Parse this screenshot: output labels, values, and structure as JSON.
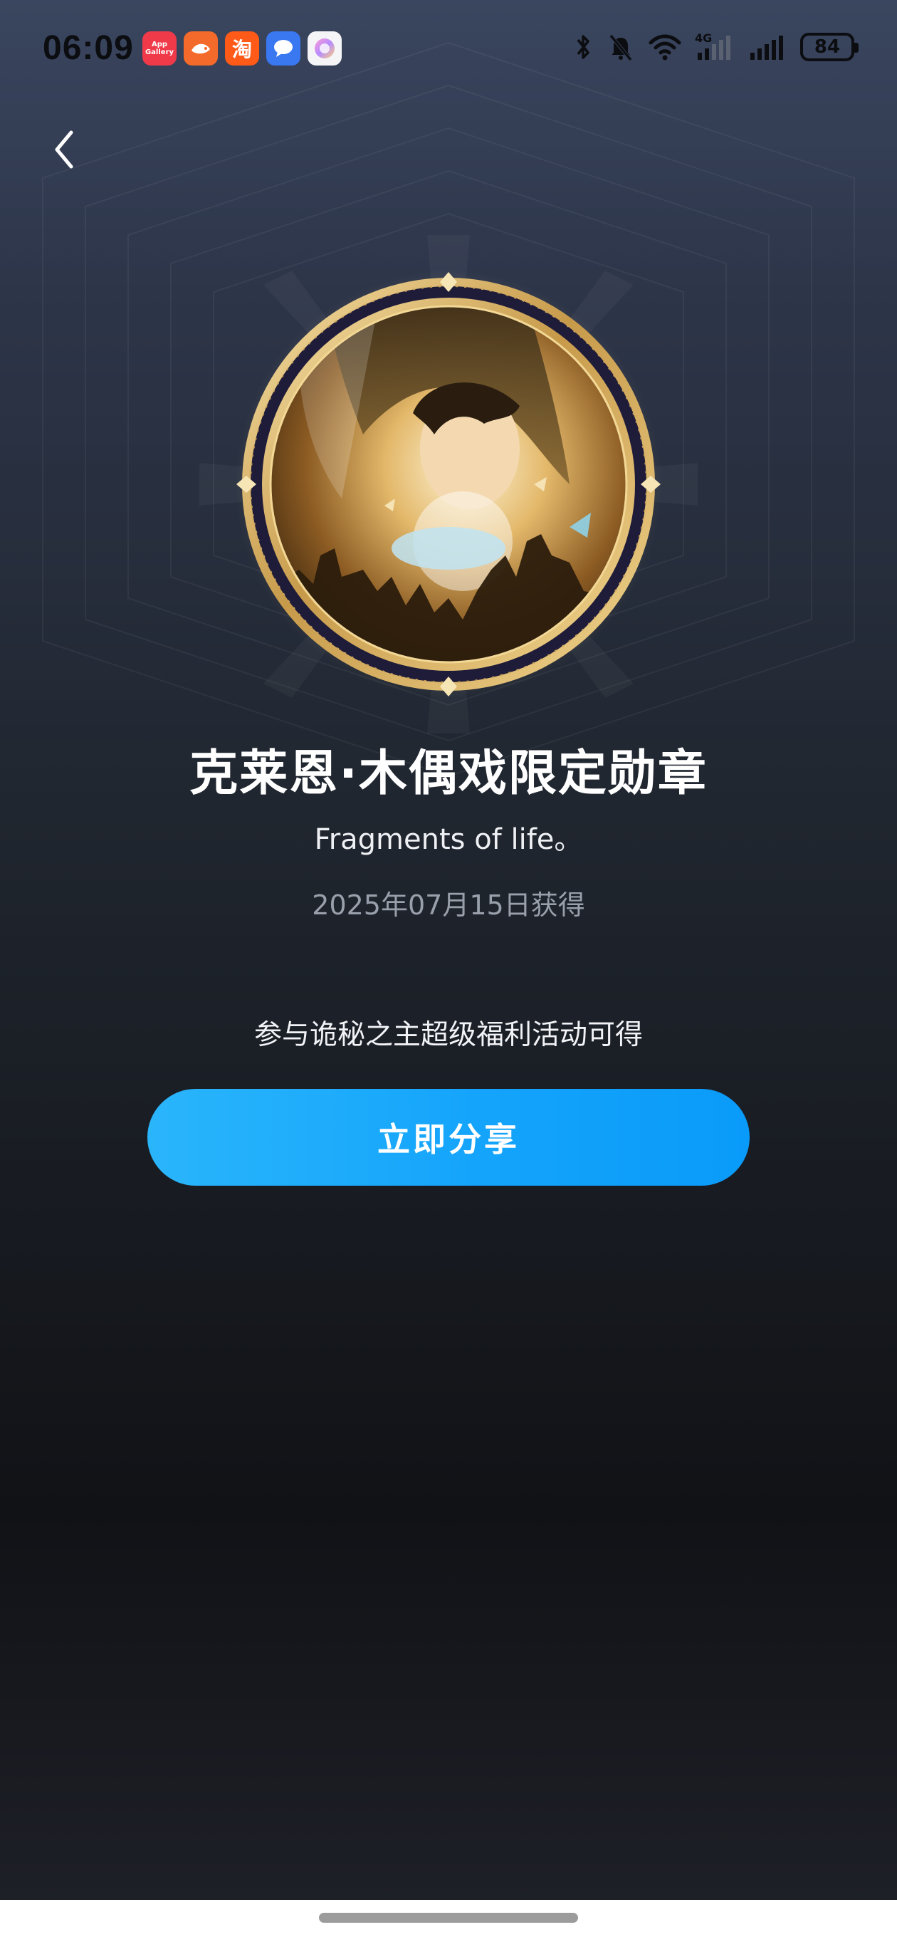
{
  "status_bar": {
    "time": "06:09",
    "battery": "84",
    "network": "4G",
    "notification_icons": [
      {
        "name": "app-gallery-icon",
        "label": "App Gallery"
      },
      {
        "name": "fish-app-icon",
        "label": ""
      },
      {
        "name": "taobao-icon",
        "label": "淘"
      },
      {
        "name": "message-icon",
        "label": ""
      },
      {
        "name": "gradient-app-icon",
        "label": ""
      }
    ]
  },
  "medal": {
    "title": "克莱恩·木偶戏限定勋章",
    "subtitle": "Fragments of life。",
    "date": "2025年07月15日获得",
    "description": "参与诡秘之主超级福利活动可得"
  },
  "actions": {
    "share_label": "立即分享"
  },
  "colors": {
    "accent": "#14a4fb",
    "medal_gold": "#d9b46a",
    "date_text": "#9aa0ab"
  }
}
